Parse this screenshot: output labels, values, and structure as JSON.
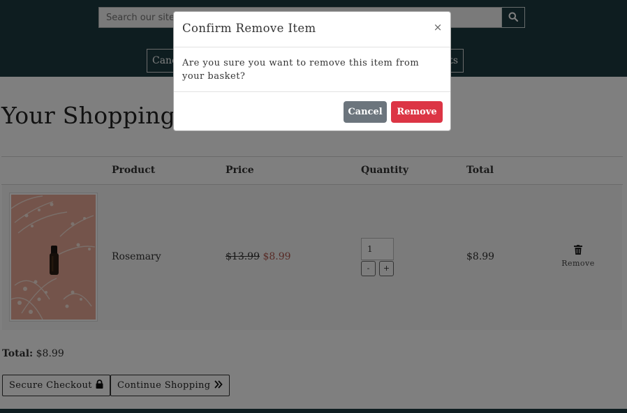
{
  "header": {
    "search_placeholder": "Search our site",
    "search_icon": "search-icon",
    "nav_items": [
      "Canc",
      "ts"
    ]
  },
  "page": {
    "title": "Your Shopping Basket"
  },
  "table": {
    "headers": [
      "Product",
      "Price",
      "Quantity",
      "Total"
    ],
    "row": {
      "image": "product-image",
      "product": "Rosemary",
      "original_price": "$13.99",
      "sale_price": "$8.99",
      "quantity": "1",
      "decrement": "-",
      "increment": "+",
      "line_total": "$8.99",
      "remove_icon": "trash-icon",
      "remove_label": "Remove"
    }
  },
  "summary": {
    "total_label": "Total:",
    "total_value": "$8.99"
  },
  "actions": {
    "checkout_label": "Secure Checkout",
    "checkout_icon": "lock-icon",
    "continue_label": "Continue Shopping",
    "continue_icon": "double-chevron-right-icon"
  },
  "modal": {
    "title": "Confirm Remove Item",
    "close": "×",
    "body": "Are you sure you want to remove this item from your basket?",
    "cancel_label": "Cancel",
    "remove_label": "Remove"
  },
  "colors": {
    "header_bg": "#1d3b40",
    "cancel_bg": "#6c757d",
    "remove_bg": "#dc3545",
    "sale_price": "#b0564d"
  }
}
